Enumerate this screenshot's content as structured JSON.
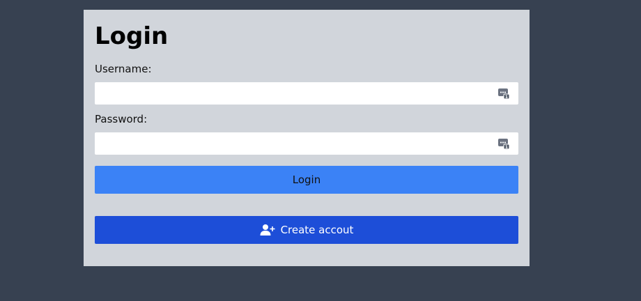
{
  "login_form": {
    "title": "Login",
    "username_label": "Username:",
    "username_value": "",
    "password_label": "Password:",
    "password_value": "",
    "login_button_label": "Login",
    "create_account_button_label": "Create accout",
    "password_manager_icon": "password-manager-icon",
    "create_account_icon": "user-plus-icon"
  },
  "colors": {
    "page_background": "#374151",
    "card_background": "#d1d5db",
    "login_button": "#3b82f6",
    "create_account_button": "#1d4ed8"
  }
}
